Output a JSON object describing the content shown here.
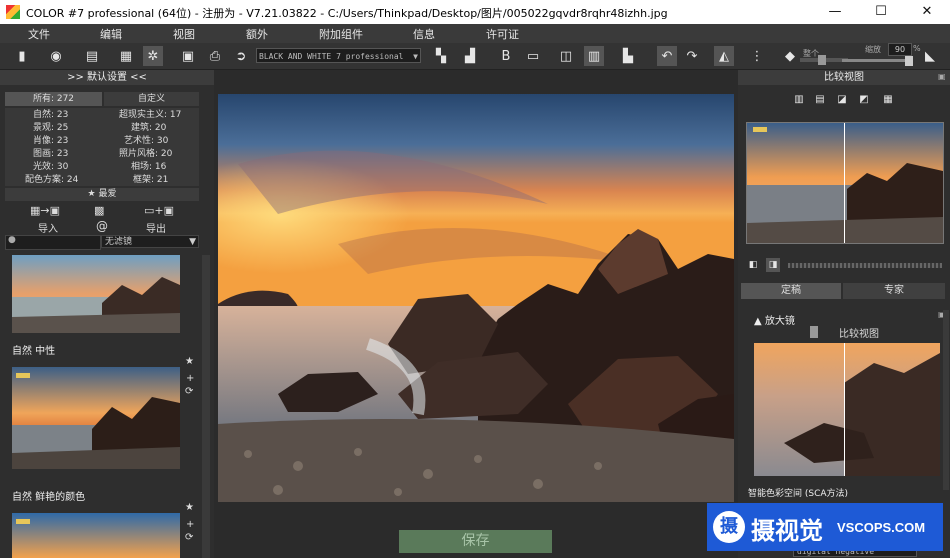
{
  "titlebar": {
    "title": "COLOR #7 professional (64位) - 注册为 - V7.21.03822 - C:/Users/Thinkpad/Desktop/图片/005022gqvdr8rqhr48izhh.jpg",
    "minimize": "—",
    "maximize": "☐",
    "close": "✕"
  },
  "menu": [
    "文件",
    "编辑",
    "视图",
    "额外",
    "附加组件",
    "信息",
    "许可证"
  ],
  "toolbar": {
    "preset": "BLACK AND WHITE 7 professional",
    "slider_label_1": "整个",
    "slider_label_2": "缩放",
    "zoom_value": "90",
    "zoom_unit": "%"
  },
  "left": {
    "header": ">> 默认设置 <<",
    "all_tab": "所有: 272",
    "custom_tab": "自定义",
    "categories": [
      {
        "a": "自然: 23",
        "b": "超现实主义: 17"
      },
      {
        "a": "景观: 25",
        "b": "建筑: 20"
      },
      {
        "a": "肖像: 23",
        "b": "艺术性: 30"
      },
      {
        "a": "图画: 23",
        "b": "照片风格: 20"
      },
      {
        "a": "光效: 30",
        "b": "相场: 16"
      },
      {
        "a": "配色方案: 24",
        "b": "框架: 21"
      }
    ],
    "favorites": "★ 最爱",
    "import": "导入",
    "export": "导出",
    "filter": "无滤镜",
    "preset1": "自然  中性",
    "preset2": "自然  鲜艳的颜色"
  },
  "center": {
    "save": "保存"
  },
  "right": {
    "header": "比较视图",
    "tab_fixed": "定稿",
    "tab_expert": "专家",
    "magnifier": "放大镜",
    "compare": "比较视图",
    "sca": "智能色彩空间 (SCA方法)",
    "negative": "digital negative"
  },
  "watermark": {
    "brand": "摄视觉",
    "domain": "VSCOPS.COM"
  }
}
